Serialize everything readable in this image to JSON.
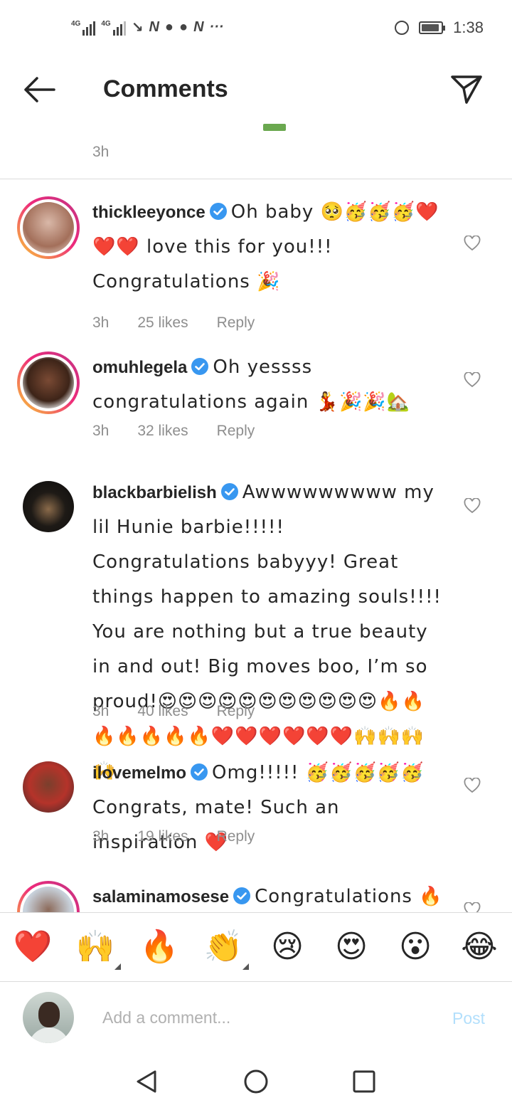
{
  "status_bar": {
    "network_1": "4G",
    "network_2": "4G",
    "time": "1:38"
  },
  "header": {
    "title": "Comments"
  },
  "previous_comment": {
    "time": "3h"
  },
  "comments": [
    {
      "username": "thickleeyonce",
      "text": "Oh baby 🥺🥳🥳🥳❤️❤️❤️ love this for you!!! Congratulations 🎉",
      "time": "3h",
      "likes": "25 likes",
      "reply": "Reply"
    },
    {
      "username": "omuhlegela",
      "text": "Oh yessss congratulations again 💃🎉🎉🏡",
      "time": "3h",
      "likes": "32 likes",
      "reply": "Reply"
    },
    {
      "username": "blackbarbielish",
      "text": "Awwwwwwwww my lil Hunie barbie!!!!! Congratulations babyyy! Great things happen to amazing souls!!!! You are nothing but a true beauty in and out! Big moves boo, I’m so proud!😍😍😍😍😍😍😍😍😍😍😍🔥🔥🔥🔥🔥🔥🔥❤️❤️❤️❤️❤️❤️🙌🙌🙌🙌",
      "time": "3h",
      "likes": "40 likes",
      "reply": "Reply"
    },
    {
      "username": "ilovemelmo",
      "text": "Omg!!!!! 🥳🥳🥳🥳🥳 Congrats, mate! Such an inspiration ❤️",
      "time": "3h",
      "likes": "19 likes",
      "reply": "Reply"
    },
    {
      "username": "salaminamosese",
      "text": "Congratulations 🔥🔥"
    }
  ],
  "reactions": [
    "❤️",
    "🙌",
    "🔥",
    "👏",
    "😢",
    "😍",
    "😮",
    "😂"
  ],
  "composer": {
    "placeholder": "Add a comment...",
    "post_label": "Post"
  },
  "colors": {
    "verified": "#3897f0",
    "heart_red": "#e0242f",
    "post_disabled": "#b2dffc",
    "meta_gray": "#8e8e8e"
  }
}
